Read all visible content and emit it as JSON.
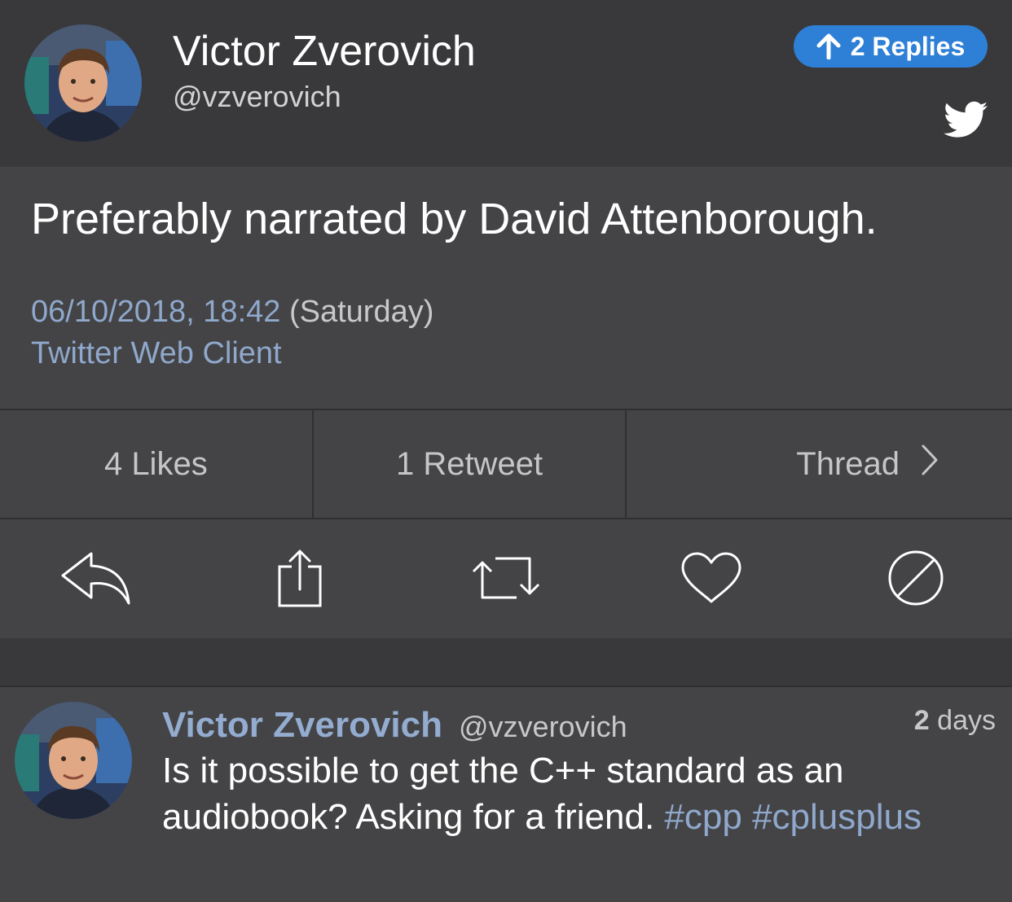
{
  "header": {
    "name": "Victor Zverovich",
    "handle": "@vzverovich",
    "replies_label": "2 Replies",
    "replies_icon": "arrow-up-icon",
    "brand_icon": "twitter-bird-icon"
  },
  "tweet": {
    "text": "Preferably narrated by David Attenborough.",
    "date": "06/10/2018, 18:42",
    "weekday": "(Saturday)",
    "client": "Twitter Web Client"
  },
  "stats": {
    "likes": "4 Likes",
    "retweets": "1 Retweet",
    "thread": "Thread"
  },
  "actions": [
    "reply-icon",
    "share-icon",
    "retweet-icon",
    "like-icon",
    "mute-icon"
  ],
  "parent": {
    "name": "Victor Zverovich",
    "handle": "@vzverovich",
    "time_value": "2",
    "time_unit": "days",
    "text": "Is it possible to get the C++ standard as an audiobook? Asking for a friend.",
    "tag1": "#cpp",
    "tag2": "#cplusplus"
  },
  "colors": {
    "background": "#444446",
    "header_background": "#39393b",
    "accent_blue": "#2e7fd6",
    "link_blue": "#8fa8cc"
  }
}
